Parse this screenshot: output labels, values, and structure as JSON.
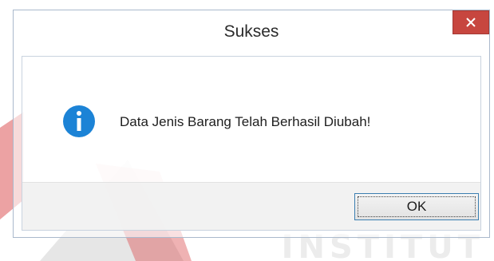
{
  "dialog": {
    "title": "Sukses",
    "close_icon": "close-icon",
    "message_icon": "info-icon",
    "message": "Data Jenis Barang Telah Berhasil Diubah!",
    "ok_label": "OK"
  },
  "background": {
    "watermark_text": "INSTITUT",
    "logo_colors": [
      "#d9484a",
      "#e8e8e8"
    ]
  },
  "colors": {
    "close_button": "#c7463f",
    "info_icon": "#1c83d6",
    "focus_border": "#3c7fb1"
  }
}
